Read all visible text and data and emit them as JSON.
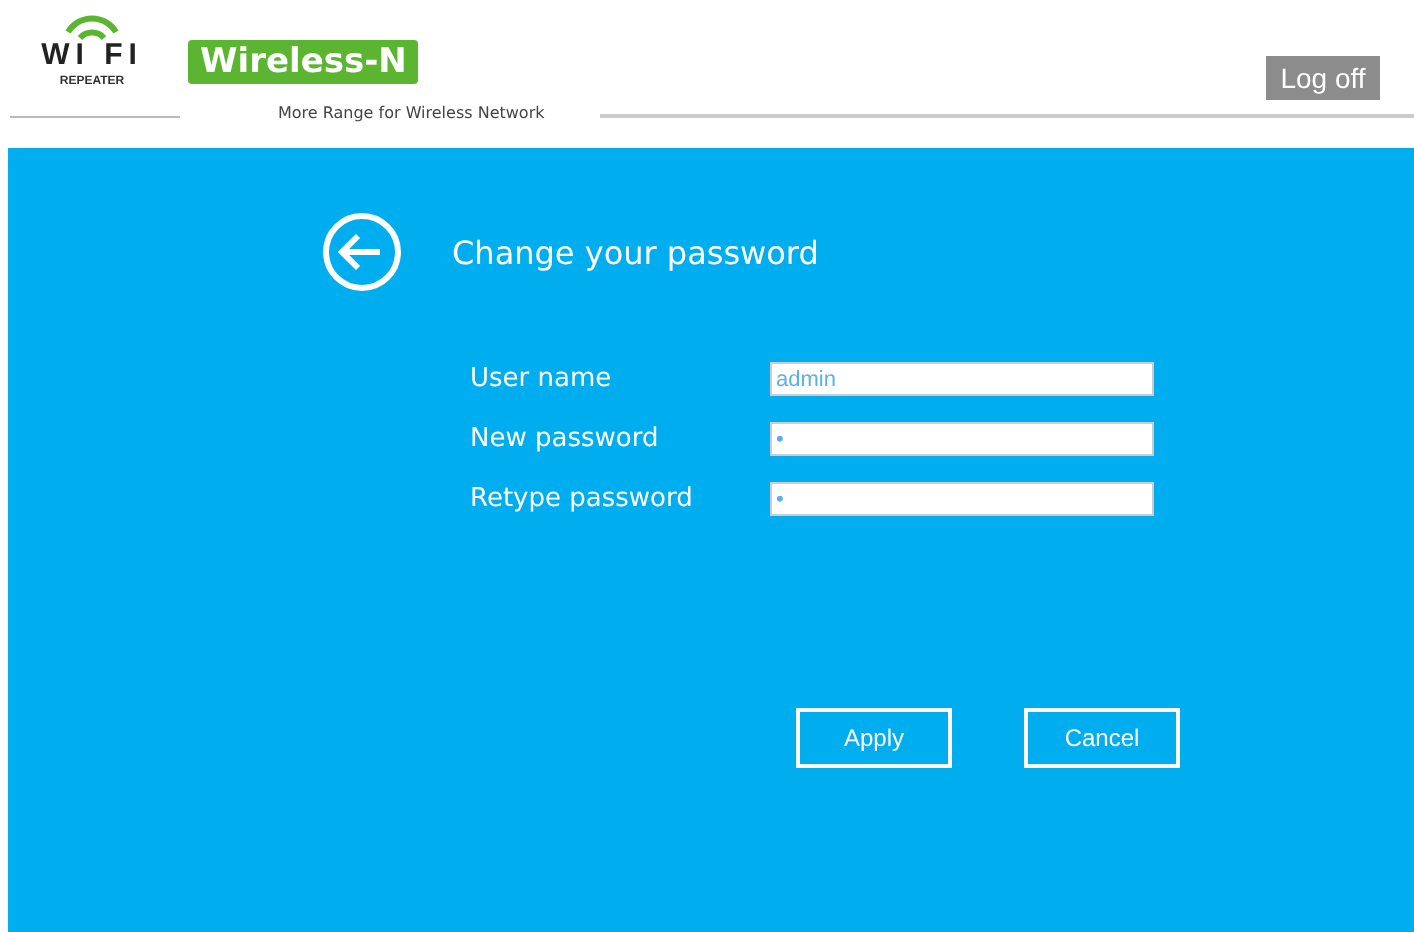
{
  "header": {
    "logo": {
      "wordmark": "WI FI",
      "subtitle": "REPEATER"
    },
    "badge": "Wireless-N",
    "tagline": "More Range for Wireless Network",
    "logoff": "Log off"
  },
  "panel": {
    "title": "Change your password",
    "fields": [
      {
        "label": "User name",
        "value": "admin"
      },
      {
        "label": "New password",
        "value": "•"
      },
      {
        "label": "Retype password",
        "value": "•"
      }
    ],
    "buttons": [
      "Apply",
      "Cancel"
    ]
  }
}
